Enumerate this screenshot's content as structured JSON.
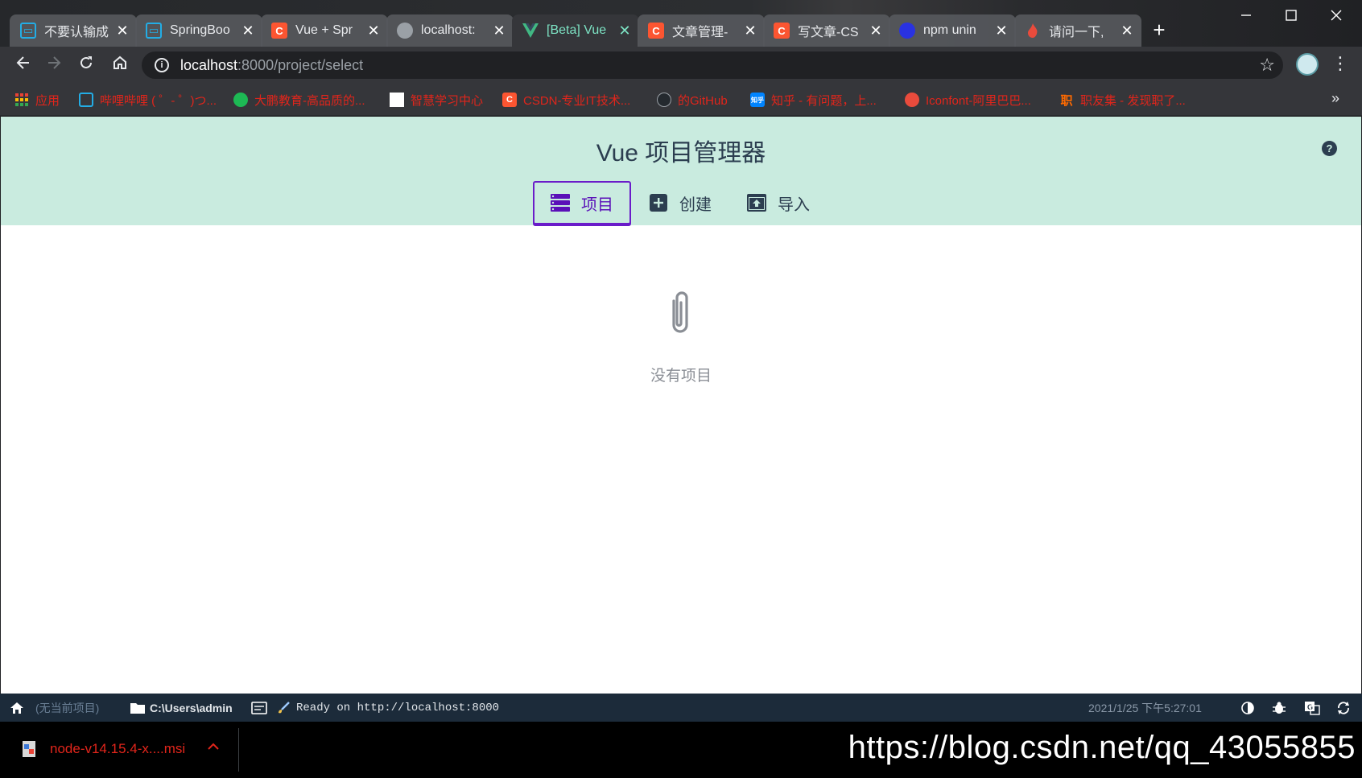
{
  "browser": {
    "tabs": [
      {
        "title": "不要认输成",
        "icon": "bilibili-icon",
        "active": false
      },
      {
        "title": "SpringBoo",
        "icon": "bilibili-icon",
        "active": false
      },
      {
        "title": "Vue + Spr",
        "icon": "csdn-icon",
        "active": false
      },
      {
        "title": "localhost:",
        "icon": "globe-icon",
        "active": false
      },
      {
        "title": "[Beta] Vue",
        "icon": "vue-icon",
        "active": true
      },
      {
        "title": "文章管理-",
        "icon": "csdn-icon",
        "active": false
      },
      {
        "title": "写文章-CS",
        "icon": "csdn-icon",
        "active": false
      },
      {
        "title": "npm unin",
        "icon": "baidu-icon",
        "active": false
      },
      {
        "title": "请问一下,",
        "icon": "flame-icon",
        "active": false
      }
    ],
    "close_glyph": "✕",
    "new_tab_glyph": "+",
    "url_host": "localhost",
    "url_path": ":8000/project/select",
    "bookmarks": [
      {
        "label": "应用",
        "icon": "apps-grid-icon"
      },
      {
        "label": "哔哩哔哩 ( ゜- ゜)つ...",
        "icon": "bilibili-icon"
      },
      {
        "label": "大鹏教育-高品质的...",
        "icon": "dapeng-icon"
      },
      {
        "label": "智慧学习中心",
        "icon": "blank-page-icon"
      },
      {
        "label": "CSDN-专业IT技术...",
        "icon": "csdn-icon"
      },
      {
        "label": "的GitHub",
        "icon": "github-icon"
      },
      {
        "label": "知乎 - 有问题，上...",
        "icon": "zhihu-icon"
      },
      {
        "label": "Iconfont-阿里巴巴...",
        "icon": "iconfont-icon"
      },
      {
        "label": "职友集 - 发现职了...",
        "icon": "zhiyouji-icon"
      }
    ],
    "bookmark_icon_text": {
      "zhihu": "知乎",
      "zhiyouji": "职",
      "csdn": "C"
    }
  },
  "app": {
    "title": "Vue 项目管理器",
    "help": "?",
    "nav": [
      {
        "label": "项目",
        "icon": "list-icon",
        "active": true
      },
      {
        "label": "创建",
        "icon": "plus-square-icon",
        "active": false
      },
      {
        "label": "导入",
        "icon": "import-icon",
        "active": false
      }
    ],
    "empty_text": "没有项目"
  },
  "statusbar": {
    "project": "(无当前项目)",
    "folder": "C:\\Users\\admin",
    "log": "Ready on http://localhost:8000",
    "datetime": "2021/1/25 下午5:27:01"
  },
  "downloads": {
    "file": "node-v14.15.4-x....msi"
  },
  "watermark": "https://blog.csdn.net/qq_43055855",
  "colors": {
    "header_bg": "#c9ebdf",
    "accent": "#6a1cc9",
    "statusbar_bg": "#1c2b3a",
    "bookmark_text": "#e1251b",
    "active_tab_text": "#7de3c4"
  }
}
